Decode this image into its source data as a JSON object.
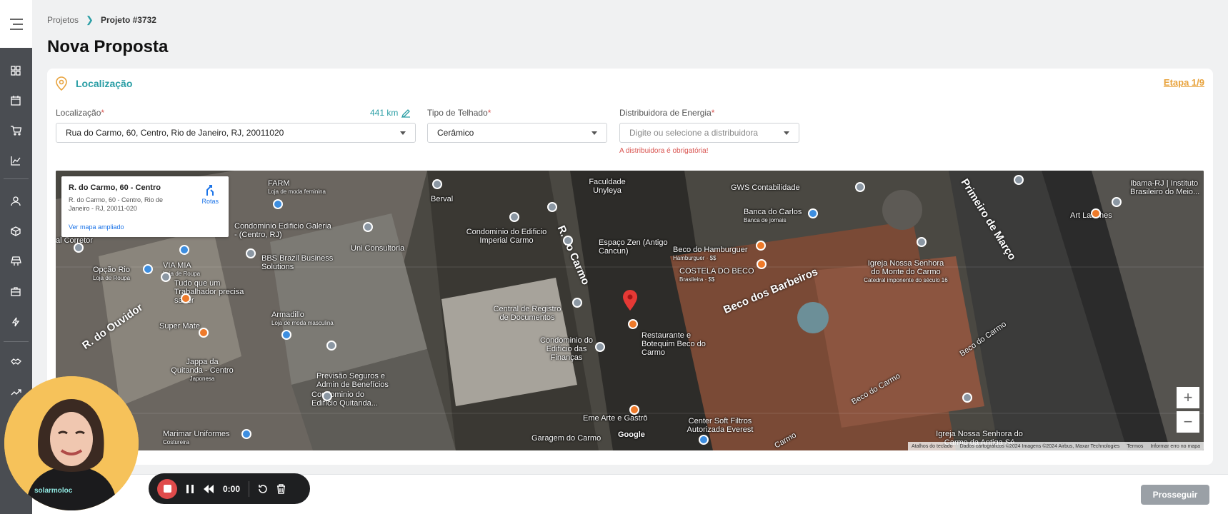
{
  "breadcrumb": {
    "parent": "Projetos",
    "current": "Projeto #3732"
  },
  "page_title": "Nova Proposta",
  "section": {
    "title": "Localização",
    "stage": "Etapa 1/9"
  },
  "form": {
    "location": {
      "label": "Localização",
      "value": "Rua do Carmo, 60, Centro, Rio de Janeiro, RJ, 20011020",
      "distance": "441 km"
    },
    "roof": {
      "label": "Tipo de Telhado",
      "value": "Cerâmico"
    },
    "distributor": {
      "label": "Distribuidora de Energia",
      "placeholder": "Digite ou selecione a distribuidora",
      "error": "A distribuidora é obrigatória!"
    },
    "required_mark": "*"
  },
  "map": {
    "info": {
      "title": "R. do Carmo, 60 - Centro",
      "address": "R. do Carmo, 60 - Centro, Rio de Janeiro - RJ, 20011-020",
      "link": "Ver mapa ampliado",
      "route": "Rotas"
    },
    "streets": [
      "R. do Carmo",
      "Beco dos Barbeiros",
      "R. do Ouvidor",
      "Primeiro de Março",
      "Beco do Carmo",
      "Beco do Carmo",
      "Carmo"
    ],
    "pois": [
      {
        "name": "FARM",
        "sub": "Loja de moda feminina"
      },
      {
        "name": "Faculdade Unyleya",
        "sub": ""
      },
      {
        "name": "GWS Contabilidade",
        "sub": ""
      },
      {
        "name": "Ibama-RJ | Instituto Brasileiro do Meio...",
        "sub": ""
      },
      {
        "name": "Banca do Carlos",
        "sub": "Banca de jornais"
      },
      {
        "name": "Art Lanches",
        "sub": ""
      },
      {
        "name": "Berval",
        "sub": ""
      },
      {
        "name": "Condominio Edificio Galeria - (Centro, RJ)",
        "sub": ""
      },
      {
        "name": "Condominio do Edificio Imperial Carmo",
        "sub": ""
      },
      {
        "name": "Espaço Zen (Antigo Cancun)",
        "sub": ""
      },
      {
        "name": "Beco do Hamburguer",
        "sub": "Hamburguer · $$"
      },
      {
        "name": "COSTELA DO BECO",
        "sub": "Brasileira · $$"
      },
      {
        "name": "Igreja Nossa Senhora do Monte do Carmo",
        "sub": "Catedral imponente do século 16"
      },
      {
        "name": "Uni Consultoria",
        "sub": ""
      },
      {
        "name": "BBS Brazil Business Solutions",
        "sub": ""
      },
      {
        "name": "Opção Rio",
        "sub": "Loja de Roupa"
      },
      {
        "name": "VIA MIA",
        "sub": "Loja de Roupa"
      },
      {
        "name": "Tudo que um Trabalhador precisa saber",
        "sub": ""
      },
      {
        "name": "Armadillo",
        "sub": "Loja de moda masculina"
      },
      {
        "name": "Super Mate",
        "sub": ""
      },
      {
        "name": "Central de Registro de Documentos",
        "sub": ""
      },
      {
        "name": "Restaurante e Botequim Beco do Carmo",
        "sub": ""
      },
      {
        "name": "Condominio do Edifício das Finanças",
        "sub": ""
      },
      {
        "name": "Jappa da Quitanda - Centro",
        "sub": "Japonesa"
      },
      {
        "name": "Previsão Seguros e Admin de Benefícios",
        "sub": ""
      },
      {
        "name": "Condominio do Edifício Quitanda...",
        "sub": ""
      },
      {
        "name": "Marimar Uniformes",
        "sub": "Costureira"
      },
      {
        "name": "Eme Arte e Gastrô",
        "sub": ""
      },
      {
        "name": "Garagem do Carmo",
        "sub": ""
      },
      {
        "name": "Center Soft Filtros Autorizada Everest",
        "sub": ""
      },
      {
        "name": "Igreja Nossa Senhora do Carmo da Antiga Sé",
        "sub": ""
      },
      {
        "name": "al Corretor",
        "sub": ""
      }
    ],
    "google": "Google",
    "attribution": [
      "Atalhos do teclado",
      "Dados cartográficos ©2024 Imagens ©2024 Airbus, Maxar Technologies",
      "Termos",
      "Informar erro no mapa"
    ],
    "zoom_in": "+",
    "zoom_out": "−"
  },
  "recorder": {
    "time": "0:00"
  },
  "footer": {
    "next": "Prosseguir"
  },
  "webcam": {
    "shirt_text": "solarmoloc"
  },
  "colors": {
    "accent": "#2a9ea5",
    "stage": "#e8a33d",
    "error": "#d9534f",
    "sidebar": "#4a4d52"
  }
}
